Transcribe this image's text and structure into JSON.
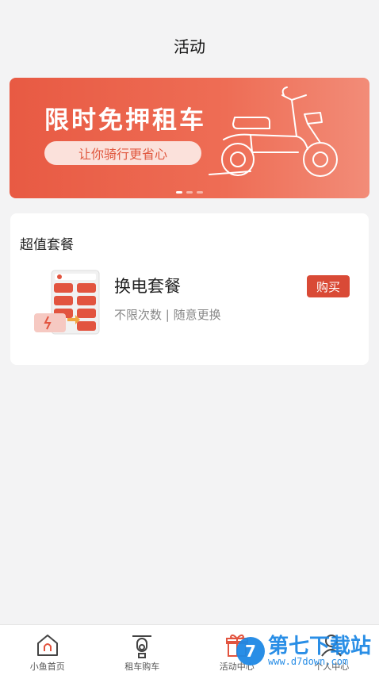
{
  "header": {
    "title": "活动"
  },
  "banner": {
    "headline": "限时免押租车",
    "subline": "让你骑行更省心",
    "slides": 3,
    "active_slide": 1
  },
  "package_section": {
    "title": "超值套餐",
    "items": [
      {
        "name": "换电套餐",
        "desc": "不限次数 | 随意更换",
        "button": "购买"
      }
    ]
  },
  "tabbar": {
    "items": [
      {
        "label": "小鱼首页",
        "icon": "home-icon"
      },
      {
        "label": "租车购车",
        "icon": "scooter-icon"
      },
      {
        "label": "活动中心",
        "icon": "gift-icon"
      },
      {
        "label": "个人中心",
        "icon": "user-icon"
      }
    ]
  },
  "watermark": {
    "brand": "第七下载站",
    "url": "www.d7down.com"
  },
  "colors": {
    "accent": "#d94a36",
    "banner": "#e85a43",
    "background": "#f3f3f4"
  }
}
